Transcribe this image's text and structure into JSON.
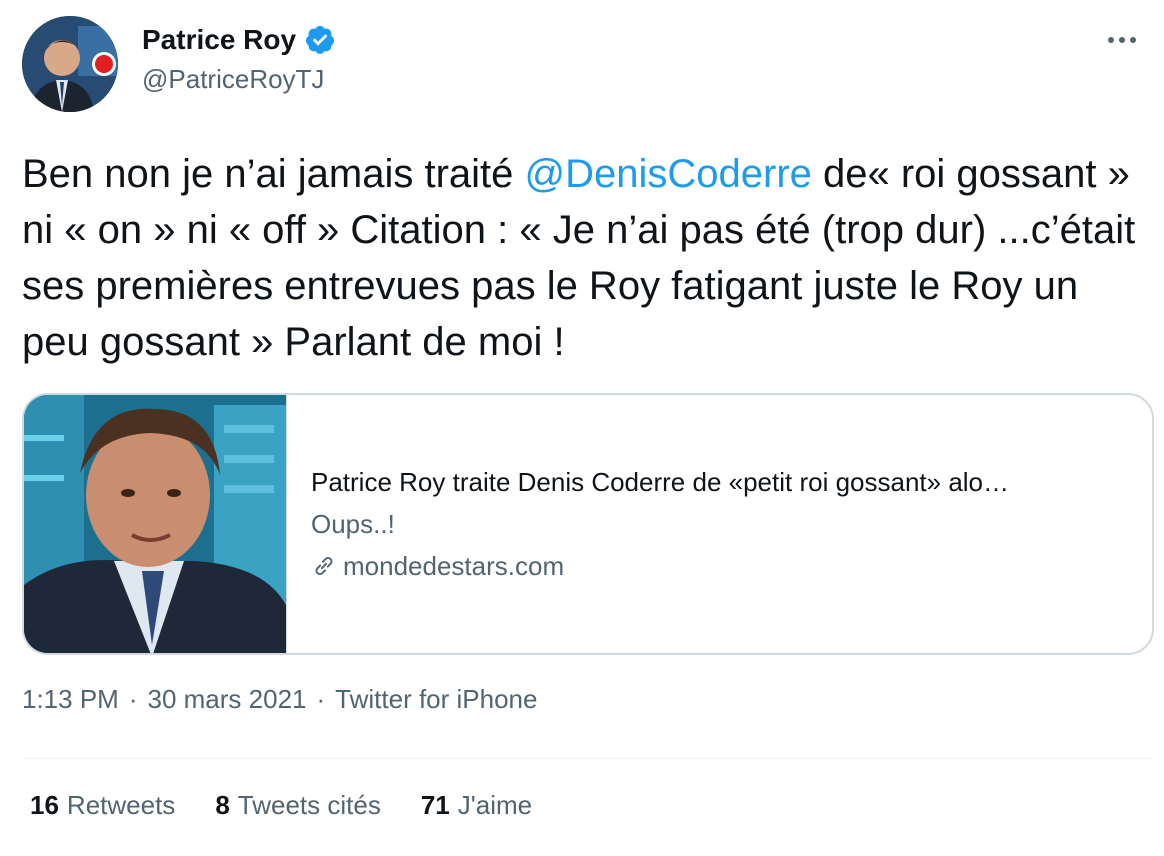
{
  "author": {
    "display_name": "Patrice Roy",
    "handle": "@PatriceRoyTJ",
    "verified": true,
    "avatar_icon": "avatar-photo"
  },
  "tweet": {
    "text_before": "Ben non je n’ai jamais traité ",
    "mention": "@DenisCoderre",
    "text_after": " de« roi gossant » ni « on » ni « off » Citation : « Je n’ai pas été (trop dur) ...c’était ses premières entrevues pas le Roy fatigant juste le Roy un peu gossant » Parlant de moi !"
  },
  "card": {
    "title": "Patrice Roy traite Denis Coderre de «petit roi gossant» alo…",
    "description": "Oups..!",
    "domain": "mondedestars.com"
  },
  "meta": {
    "time": "1:13 PM",
    "separator": "·",
    "date": "30 mars 2021",
    "source": "Twitter for iPhone"
  },
  "stats": {
    "retweets_count": "16",
    "retweets_label": "Retweets",
    "quotes_count": "8",
    "quotes_label": "Tweets cités",
    "likes_count": "71",
    "likes_label": "J'aime"
  },
  "colors": {
    "accent": "#1d9bf0",
    "secondary_text": "#536471",
    "border": "#cfd9de"
  }
}
